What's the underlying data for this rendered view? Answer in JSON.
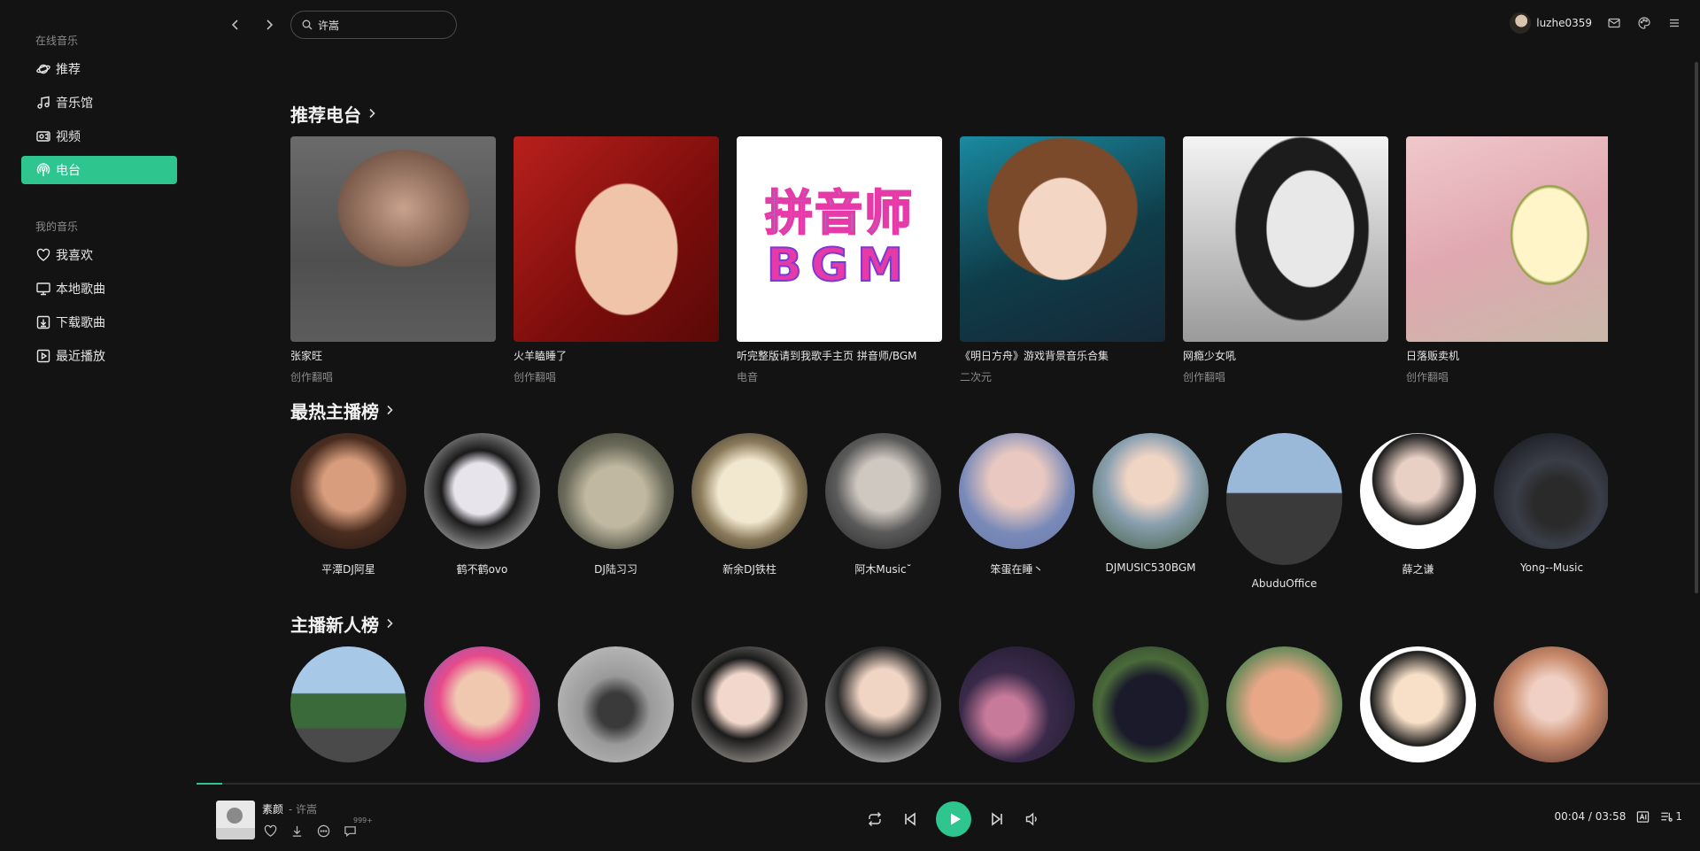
{
  "sidebar": {
    "online_heading": "在线音乐",
    "online_items": [
      {
        "label": "推荐",
        "icon": "planet-icon"
      },
      {
        "label": "音乐馆",
        "icon": "music-note-icon"
      },
      {
        "label": "视频",
        "icon": "video-icon"
      },
      {
        "label": "电台",
        "icon": "radio-icon",
        "active": true
      }
    ],
    "my_heading": "我的音乐",
    "my_items": [
      {
        "label": "我喜欢",
        "icon": "heart-icon"
      },
      {
        "label": "本地歌曲",
        "icon": "monitor-icon"
      },
      {
        "label": "下载歌曲",
        "icon": "download-icon"
      },
      {
        "label": "最近播放",
        "icon": "play-history-icon"
      }
    ]
  },
  "topbar": {
    "search_value": "许嵩",
    "username": "luzhe0359"
  },
  "sections": {
    "radio_title": "推荐电台",
    "hot_title": "最热主播榜",
    "new_title": "主播新人榜"
  },
  "radio_cards": [
    {
      "name": "张家旺",
      "tag": "创作翻唱"
    },
    {
      "name": "火羊瞌睡了",
      "tag": "创作翻唱"
    },
    {
      "name": "听完整版请到我歌手主页 拼音师/BGM",
      "tag": "电音",
      "cover_text_1": "拼音师",
      "cover_text_2": "BGM"
    },
    {
      "name": "《明日方舟》游戏背景音乐合集",
      "tag": "二次元"
    },
    {
      "name": "网瘾少女吼",
      "tag": "创作翻唱"
    },
    {
      "name": "日落贩卖机",
      "tag": "创作翻唱"
    }
  ],
  "hot_anchors": [
    {
      "name": "平潭DJ阿星"
    },
    {
      "name": "鹤不鹤ovo"
    },
    {
      "name": "DJ陆习习"
    },
    {
      "name": "新余DJ铁柱"
    },
    {
      "name": "阿木Music˘"
    },
    {
      "name": "笨蛋在睡丶"
    },
    {
      "name": "DJMUSIC530BGM"
    },
    {
      "name": "AbuduOffice"
    },
    {
      "name": "薛之谦"
    },
    {
      "name": "Yong--Music"
    }
  ],
  "new_anchors_count_visible": 10,
  "player": {
    "song": "素颜",
    "artist": "- 许嵩",
    "comment_count": "999+",
    "time": "00:04 / 03:58",
    "progress": 0.017,
    "queue_count": "1",
    "accent": "#2ec58f"
  }
}
